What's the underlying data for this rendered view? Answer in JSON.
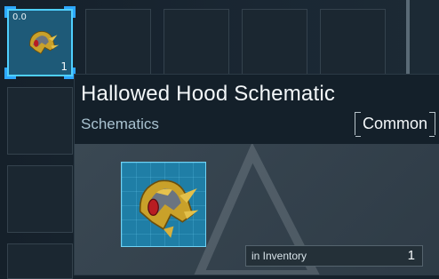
{
  "inventory": {
    "selected_slot": {
      "value_label": "0.0",
      "quantity": "1",
      "icon": "hallowed-hood-icon"
    }
  },
  "tooltip": {
    "title": "Hallowed Hood Schematic",
    "category": "Schematics",
    "rarity": "Common",
    "inventory_label": "in Inventory",
    "inventory_count": "1",
    "icon": "hallowed-hood-icon"
  },
  "colors": {
    "selection_accent": "#2ea8ff",
    "preview_bg": "#1f7ea6",
    "panel_bg": "#0f1820"
  }
}
